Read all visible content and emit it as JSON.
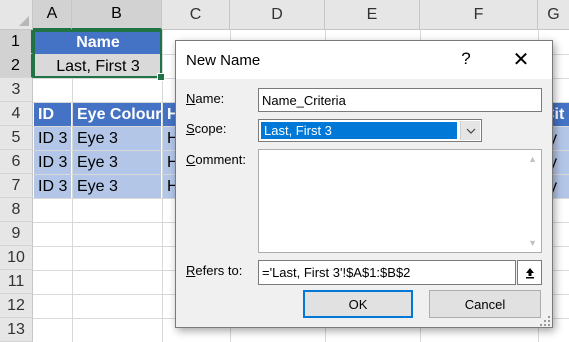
{
  "sheet": {
    "columns": [
      "A",
      "B",
      "C",
      "D",
      "E",
      "F",
      "G"
    ],
    "selected_columns": [
      "A",
      "B"
    ],
    "rows": [
      "1",
      "2",
      "3",
      "4",
      "5",
      "6",
      "7",
      "8",
      "9",
      "10",
      "11",
      "12",
      "13"
    ],
    "selected_rows": [
      "1",
      "2"
    ],
    "cells": {
      "b1_name_header": "Name",
      "b2_name_value": "Last, First 3",
      "row4": [
        "ID",
        "Eye Colour",
        "H",
        "Cit"
      ],
      "row5": [
        "ID 3",
        "Eye 3",
        "H",
        "ity"
      ],
      "row6": [
        "ID 3",
        "Eye 3",
        "H",
        "ity"
      ],
      "row7": [
        "ID 3",
        "Eye 3",
        "H",
        "ity"
      ]
    },
    "colors": {
      "header_fill": "#4472c4",
      "data_fill": "#b4c6e7",
      "selection": "#217346"
    }
  },
  "dialog": {
    "title": "New Name",
    "help": "?",
    "close": "✕",
    "name_label": "Name:",
    "name_value": "Name_Criteria",
    "scope_label": "Scope:",
    "scope_value": "Last, First 3",
    "comment_label": "Comment:",
    "comment_value": "",
    "refers_label": "Refers to:",
    "refers_value": "='Last, First 3'!$A$1:$B$2",
    "ok_label": "OK",
    "cancel_label": "Cancel",
    "icons": {
      "scope_dropdown": "chevron-down-icon",
      "refers_collapse": "collapse-dialog-icon",
      "resize": "resize-grip-icon"
    }
  }
}
